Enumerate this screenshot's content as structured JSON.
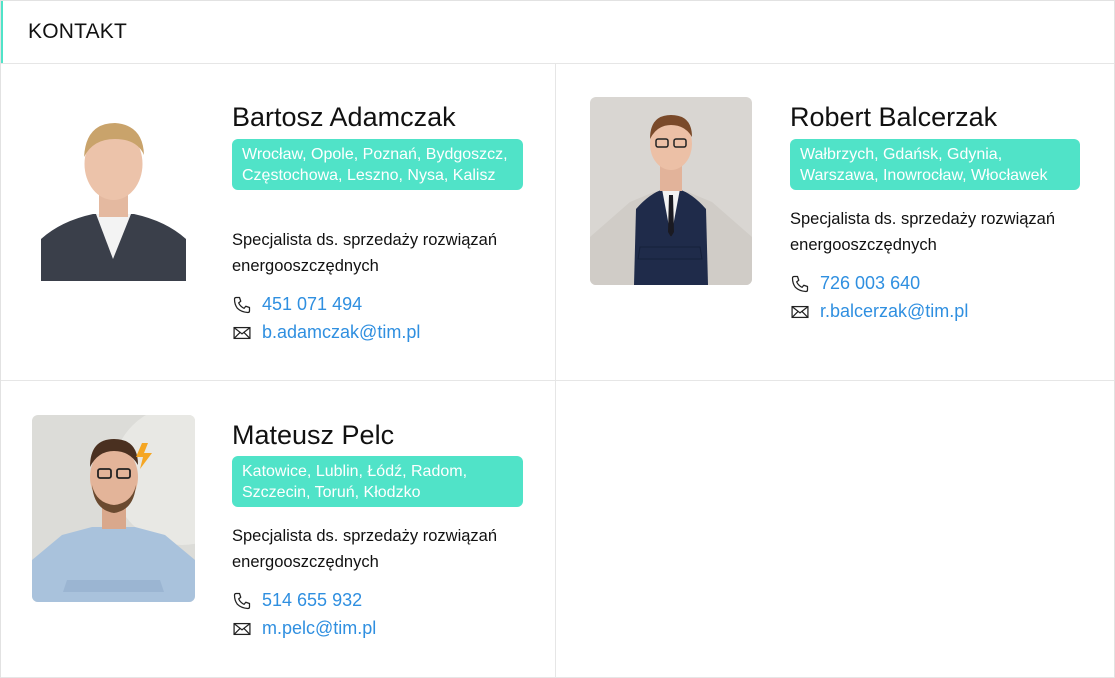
{
  "header": {
    "title": "KONTAKT"
  },
  "contacts": [
    {
      "name": "Bartosz Adamczak",
      "regions": "Wrocław, Opole, Poznań, Bydgoszcz, Częstochowa, Leszno, Nysa, Kalisz",
      "role": "Specjalista ds. sprzedaży rozwiązań energooszczędnych",
      "phone": "451 071 494",
      "email": "b.adamczak@tim.pl",
      "photo": "portrait-photo"
    },
    {
      "name": "Robert Balcerzak",
      "regions": "Wałbrzych, Gdańsk, Gdynia, Warszawa, Inowrocław, Włocławek",
      "role": "Specjalista ds. sprzedaży rozwiązań energooszczędnych",
      "phone": "726 003 640",
      "email": "r.balcerzak@tim.pl",
      "photo": "portrait-photo"
    },
    {
      "name": "Mateusz Pelc",
      "regions": "Katowice, Lublin, Łódź, Radom, Szczecin, Toruń, Kłodzko",
      "role": "Specjalista ds. sprzedaży rozwiązań energooszczędnych",
      "phone": "514 655 932",
      "email": "m.pelc@tim.pl",
      "photo": "portrait-photo"
    }
  ],
  "icons": {
    "phone": "phone-icon",
    "email": "envelope-icon"
  },
  "colors": {
    "accent": "#50e3c8",
    "link": "#2f8fe0"
  }
}
